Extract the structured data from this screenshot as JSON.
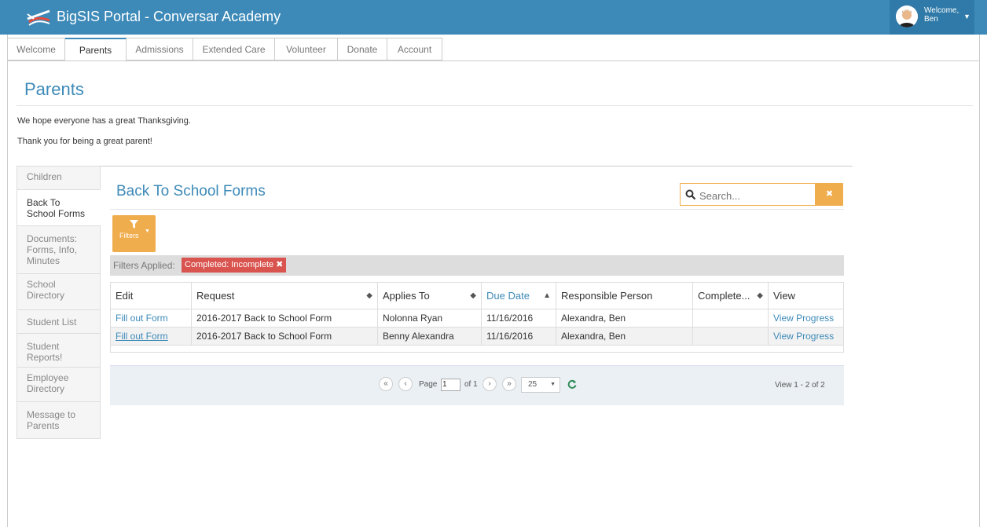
{
  "header": {
    "title": "BigSIS Portal - Conversar Academy",
    "welcome_line1": "Welcome,",
    "welcome_line2": "Ben"
  },
  "tabs": [
    {
      "label": "Welcome",
      "active": false
    },
    {
      "label": "Parents",
      "active": true
    },
    {
      "label": "Admissions",
      "active": false
    },
    {
      "label": "Extended Care",
      "active": false
    },
    {
      "label": "Volunteer",
      "active": false
    },
    {
      "label": "Donate",
      "active": false
    },
    {
      "label": "Account",
      "active": false
    }
  ],
  "page": {
    "title": "Parents",
    "message1": "We hope everyone has a great Thanksgiving.",
    "message2": "Thank you for being a great parent!"
  },
  "sidebar": {
    "items": [
      {
        "line1": "Children",
        "line2": "",
        "line3": ""
      },
      {
        "line1": "Back To",
        "line2": "School Forms",
        "line3": ""
      },
      {
        "line1": "Documents:",
        "line2": "Forms, Info,",
        "line3": "Minutes"
      },
      {
        "line1": "School",
        "line2": "Directory",
        "line3": ""
      },
      {
        "line1": "Student List",
        "line2": "",
        "line3": ""
      },
      {
        "line1": "Student",
        "line2": "Reports!",
        "line3": ""
      },
      {
        "line1": "Employee",
        "line2": "Directory",
        "line3": ""
      },
      {
        "line1": "Message to",
        "line2": "Parents",
        "line3": ""
      }
    ]
  },
  "section": {
    "title": "Back To School Forms"
  },
  "search": {
    "placeholder": "Search..."
  },
  "filters": {
    "button_label": "Filters",
    "applied_label": "Filters Applied:",
    "chips": [
      {
        "label": "Completed: Incomplete"
      }
    ]
  },
  "table": {
    "columns": {
      "edit": "Edit",
      "request": "Request",
      "applies_to": "Applies To",
      "due_date": "Due Date",
      "responsible": "Responsible Person",
      "completed": "Complete...",
      "view": "View"
    },
    "rows": [
      {
        "edit": "Fill out Form",
        "request": "2016-2017 Back to School Form",
        "applies_to": "Nolonna Ryan",
        "due_date": "11/16/2016",
        "responsible": "Alexandra, Ben",
        "completed": "",
        "view": "View Progress"
      },
      {
        "edit": "Fill out Form",
        "request": "2016-2017 Back to School Form",
        "applies_to": "Benny Alexandra",
        "due_date": "11/16/2016",
        "responsible": "Alexandra, Ben",
        "completed": "",
        "view": "View Progress"
      }
    ]
  },
  "pager": {
    "page_label": "Page",
    "page_value": "1",
    "of_label": "of 1",
    "page_size": "25",
    "view_count": "View 1 - 2 of 2"
  },
  "colors": {
    "header_bg": "#3d8ab8",
    "accent_orange": "#f0ad4e",
    "chip_red": "#d9534f"
  }
}
